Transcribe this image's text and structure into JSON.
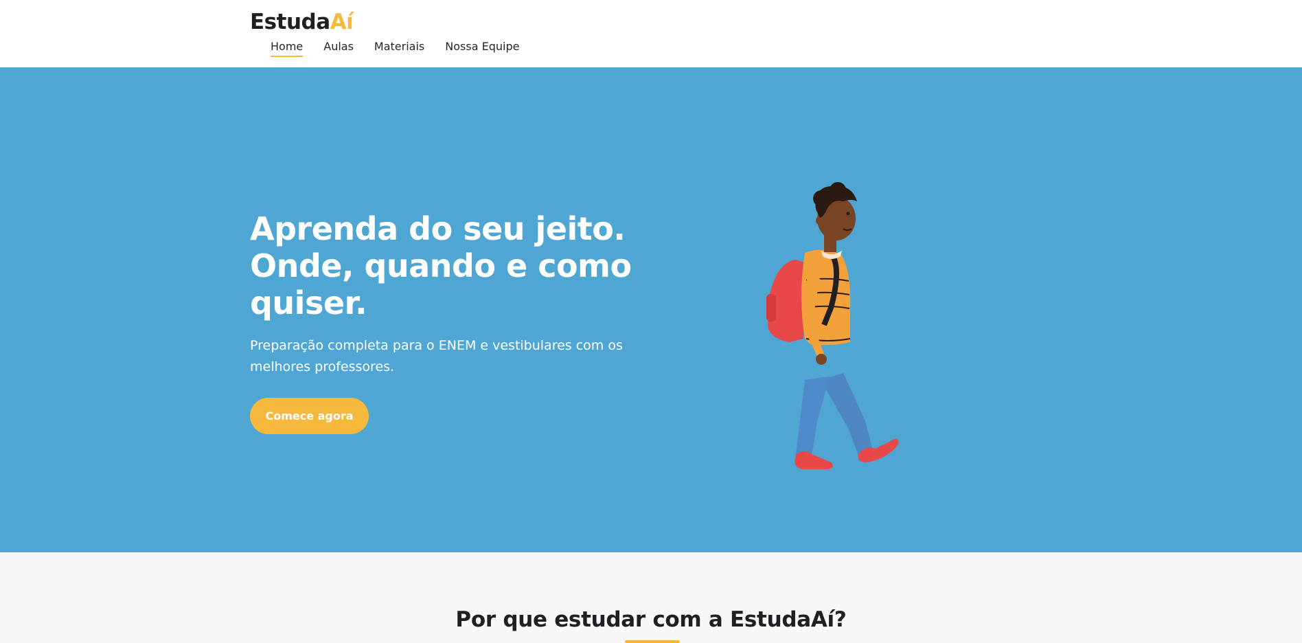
{
  "header": {
    "logo_main": "Estuda",
    "logo_accent": "Aí",
    "nav": [
      {
        "label": "Home",
        "active": true
      },
      {
        "label": "Aulas",
        "active": false
      },
      {
        "label": "Materiais",
        "active": false
      },
      {
        "label": "Nossa Equipe",
        "active": false
      }
    ]
  },
  "hero": {
    "title_lines": [
      "Aprenda do seu jeito.",
      "Onde, quando e como",
      "quiser."
    ],
    "subtitle": "Preparação completa para o ENEM e vestibulares com os melhores professores.",
    "cta_label": "Comece agora"
  },
  "features": {
    "title": "Por que estudar com a EstudaAí?"
  },
  "colors": {
    "accent": "#f6b93b",
    "hero_bg": "#4fa6d3"
  }
}
